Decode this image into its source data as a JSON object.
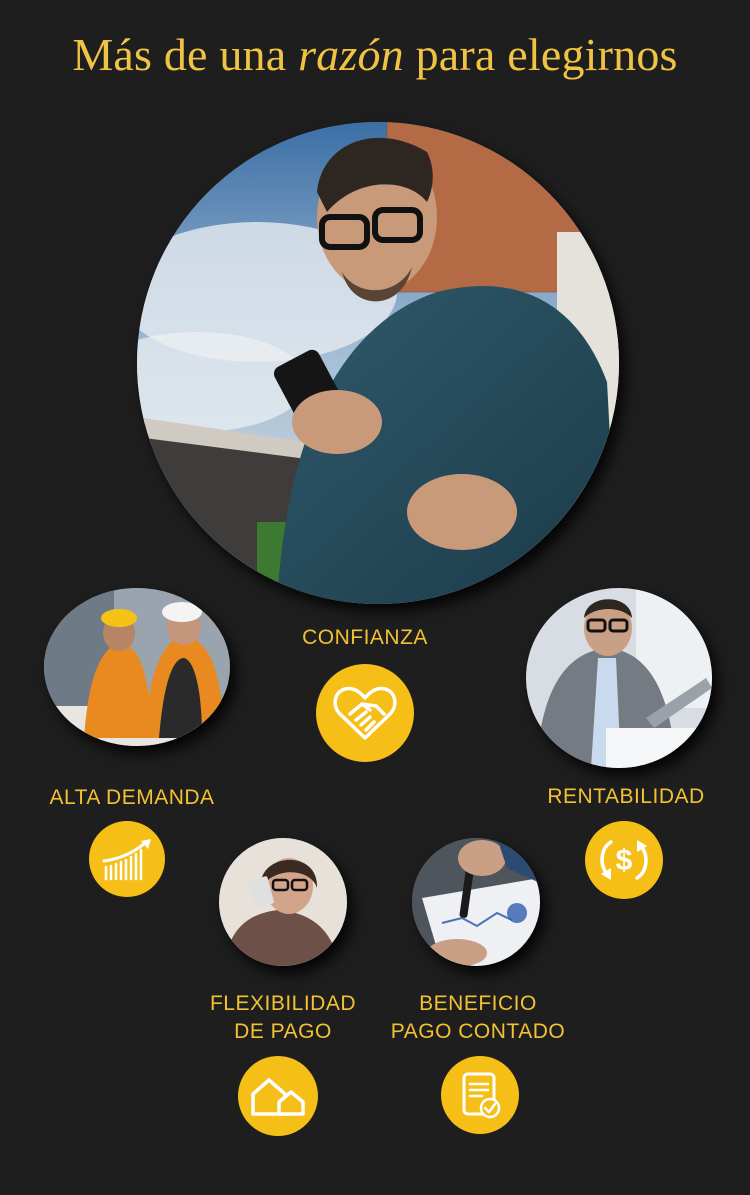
{
  "headline": {
    "before": "Más de una ",
    "emphasis": "razón",
    "after": " para elegirnos"
  },
  "photos": {
    "main": "man-with-phone-photo",
    "alta_demanda": "construction-workers-photo",
    "rentabilidad": "businessman-laptop-photo",
    "flexibilidad": "woman-with-card-photo",
    "beneficio": "signing-document-photo"
  },
  "reasons": {
    "confianza": {
      "label": "CONFIANZA",
      "icon": "handshake-heart-icon"
    },
    "alta_demanda": {
      "label": "ALTA DEMANDA",
      "icon": "growth-chart-icon"
    },
    "rentabilidad": {
      "label": "RENTABILIDAD",
      "icon": "money-cycle-icon"
    },
    "flexibilidad": {
      "line1": "FLEXIBILIDAD",
      "line2": "DE PAGO",
      "icon": "houses-icon"
    },
    "beneficio": {
      "line1": "BENEFICIO",
      "line2": "PAGO CONTADO",
      "icon": "document-check-icon"
    }
  },
  "colors": {
    "background": "#1f1e1e",
    "accent": "#f5bf18",
    "text": "#f2c233"
  }
}
